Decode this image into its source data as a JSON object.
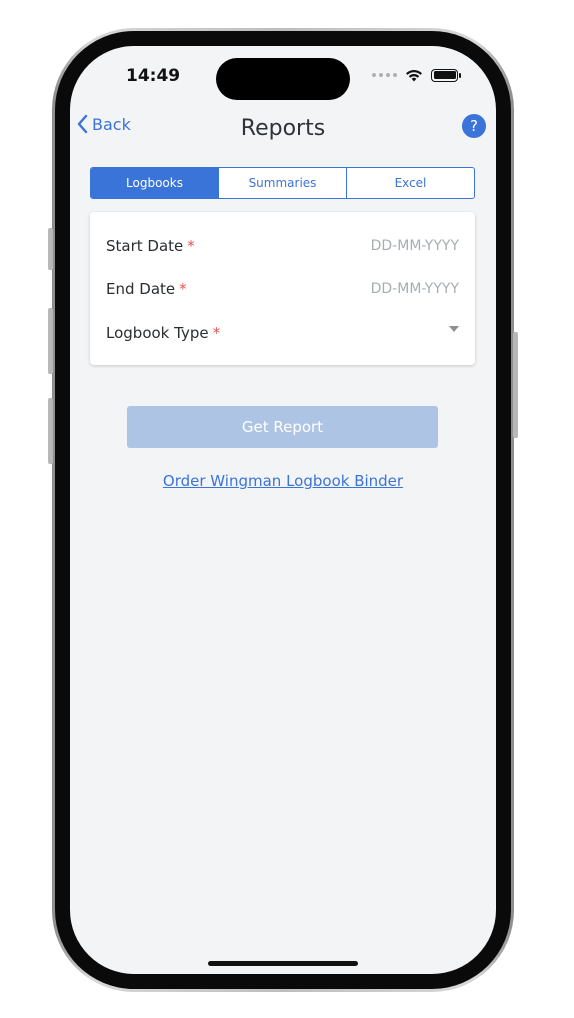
{
  "status_bar": {
    "time": "14:49"
  },
  "nav": {
    "back_label": "Back",
    "title": "Reports",
    "help_label": "?"
  },
  "tabs": [
    {
      "label": "Logbooks",
      "active": true
    },
    {
      "label": "Summaries",
      "active": false
    },
    {
      "label": "Excel",
      "active": false
    }
  ],
  "form": {
    "start_date": {
      "label": "Start Date",
      "required_mark": "*",
      "placeholder": "DD-MM-YYYY"
    },
    "end_date": {
      "label": "End Date",
      "required_mark": "*",
      "placeholder": "DD-MM-YYYY"
    },
    "logbook_type": {
      "label": "Logbook Type",
      "required_mark": "*"
    }
  },
  "actions": {
    "get_report_label": "Get Report",
    "order_link_label": "Order Wingman Logbook Binder"
  },
  "colors": {
    "accent": "#3b74d8",
    "button_disabled": "#aec4e4",
    "required": "#e25555",
    "background": "#f3f4f6"
  },
  "icons": {
    "back": "chevron-left-icon",
    "help": "question-mark-icon",
    "dropdown": "caret-down-icon",
    "wifi": "wifi-icon",
    "battery": "battery-icon"
  }
}
